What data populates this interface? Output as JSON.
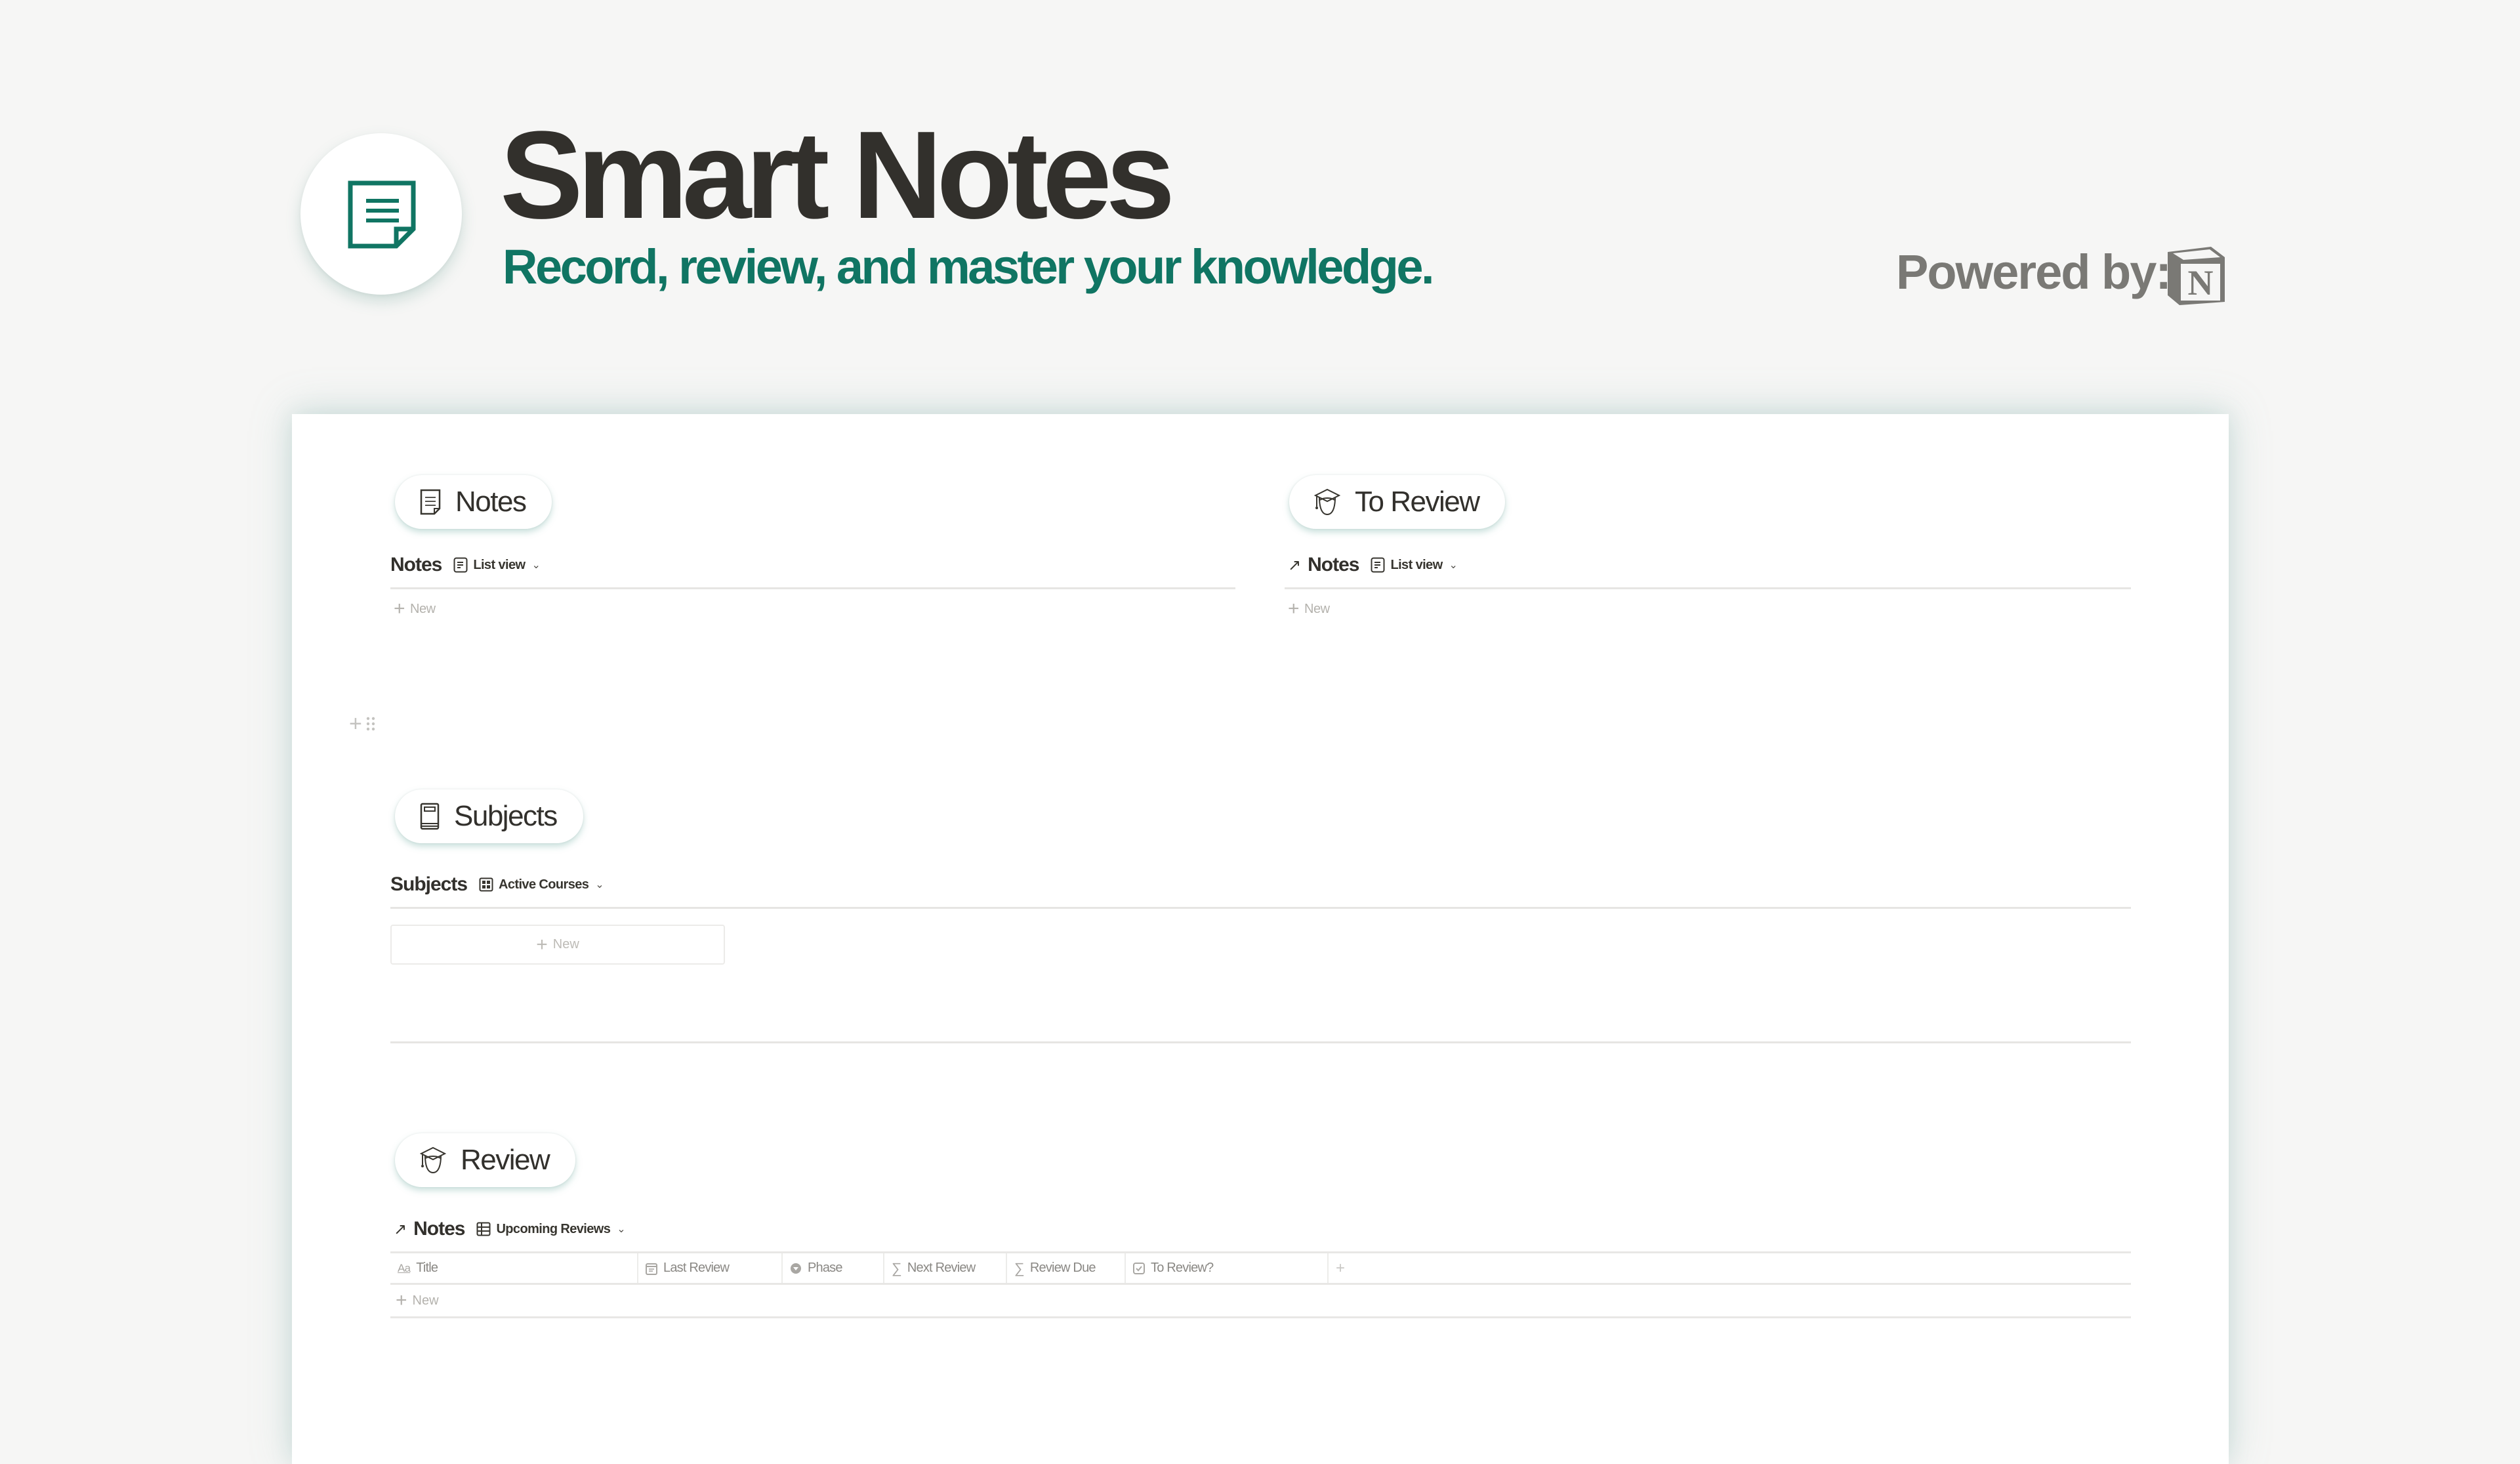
{
  "header": {
    "title": "Smart Notes",
    "subtitle": "Record, review, and master your knowledge.",
    "powered_by": "Powered by:",
    "logo_icon": "note-icon",
    "partner_logo": "notion-logo",
    "brand_color": "#107563",
    "title_color": "#32302c"
  },
  "sections": {
    "notes": {
      "heading": "Notes",
      "heading_icon": "note-icon",
      "database_title": "Notes",
      "view_icon": "list-view-icon",
      "view_label": "List view",
      "new_label": "New"
    },
    "to_review": {
      "heading": "To Review",
      "heading_icon": "graduate-icon",
      "link_icon": "linked-arrow-icon",
      "link_arrow": "↗",
      "database_title": "Notes",
      "view_icon": "list-view-icon",
      "view_label": "List view",
      "new_label": "New"
    },
    "subjects": {
      "heading": "Subjects",
      "heading_icon": "book-icon",
      "database_title": "Subjects",
      "view_icon": "gallery-view-icon",
      "view_label": "Active Courses",
      "new_label": "New"
    },
    "review": {
      "heading": "Review",
      "heading_icon": "graduate-icon",
      "link_icon": "linked-arrow-icon",
      "link_arrow": "↗",
      "database_title": "Notes",
      "view_icon": "table-view-icon",
      "view_label": "Upcoming Reviews",
      "columns": [
        {
          "label": "Title",
          "icon": "text-property-icon"
        },
        {
          "label": "Last Review",
          "icon": "date-property-icon"
        },
        {
          "label": "Phase",
          "icon": "status-property-icon"
        },
        {
          "label": "Next Review",
          "icon": "formula-property-icon"
        },
        {
          "label": "Review Due",
          "icon": "formula-property-icon"
        },
        {
          "label": "To Review?",
          "icon": "checkbox-property-icon"
        }
      ],
      "add_column_label": "+",
      "new_label": "New"
    }
  }
}
